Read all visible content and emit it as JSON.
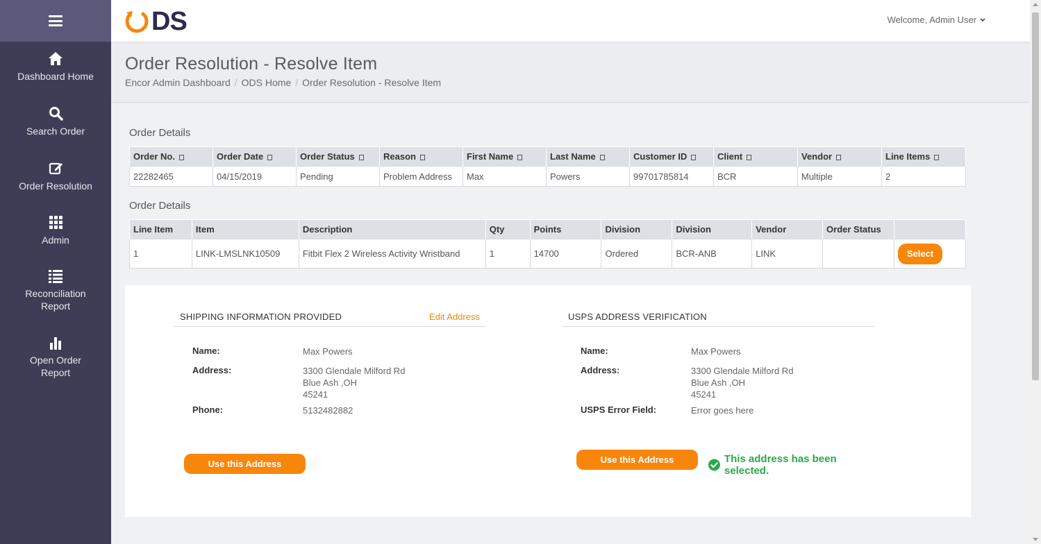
{
  "topbar": {
    "logo_text": "ODS",
    "welcome": "Welcome, Admin User"
  },
  "sidebar": {
    "items": [
      {
        "label": "Dashboard Home",
        "icon": "home-icon"
      },
      {
        "label": "Search Order",
        "icon": "search-icon"
      },
      {
        "label": "Order Resolution",
        "icon": "edit-icon"
      },
      {
        "label": "Admin",
        "icon": "grid-icon"
      },
      {
        "label": "Reconciliation Report",
        "icon": "list-icon"
      },
      {
        "label": "Open Order Report",
        "icon": "bar-chart-icon"
      }
    ]
  },
  "header": {
    "title": "Order Resolution - Resolve Item",
    "breadcrumb": [
      "Encor Admin Dashboard",
      "ODS Home",
      "Order Resolution - Resolve Item"
    ]
  },
  "order_table": {
    "title": "Order Details",
    "columns": [
      "Order No.",
      "Order Date",
      "Order Status",
      "Reason",
      "First Name",
      "Last Name",
      "Customer ID",
      "Client",
      "Vendor",
      "Line Items"
    ],
    "row": [
      "22282465",
      "04/15/2019",
      "Pending",
      "Problem Address",
      "Max",
      "Powers",
      "99701785814",
      "BCR",
      "Multiple",
      "2"
    ]
  },
  "line_table": {
    "title": "Order Details",
    "columns": [
      "Line Item",
      "Item",
      "Description",
      "Qty",
      "Points",
      "Division",
      "Division",
      "Vendor",
      "Order Status",
      ""
    ],
    "row": [
      "1",
      "LINK-LMSLNK10509",
      "Fitbit Flex 2 Wireless Activity Wristband",
      "1",
      "14700",
      "Ordered",
      "BCR-ANB",
      "LINK",
      ""
    ],
    "select_label": "Select"
  },
  "shipping": {
    "heading": "SHIPPING INFORMATION PROVIDED",
    "edit_label": "Edit Address",
    "name_label": "Name:",
    "name": "Max Powers",
    "address_label": "Address:",
    "address_line1": "3300 Glendale Milford Rd",
    "address_line2": "Blue Ash ,OH",
    "address_line3": "45241",
    "phone_label": "Phone:",
    "phone": "5132482882",
    "button": "Use this Address"
  },
  "usps": {
    "heading": "USPS ADDRESS VERIFICATION",
    "name_label": "Name:",
    "name": "Max Powers",
    "address_label": "Address:",
    "address_line1": "3300 Glendale Milford Rd",
    "address_line2": "Blue Ash ,OH",
    "address_line3": "45241",
    "error_label": "USPS Error Field:",
    "error": "Error goes here",
    "button": "Use this Address",
    "selected_msg": "This address has been selected."
  },
  "colors": {
    "accent": "#f7860b",
    "sidebar": "#3f3d56",
    "success": "#2aa84a",
    "link": "#3a6fb5"
  }
}
